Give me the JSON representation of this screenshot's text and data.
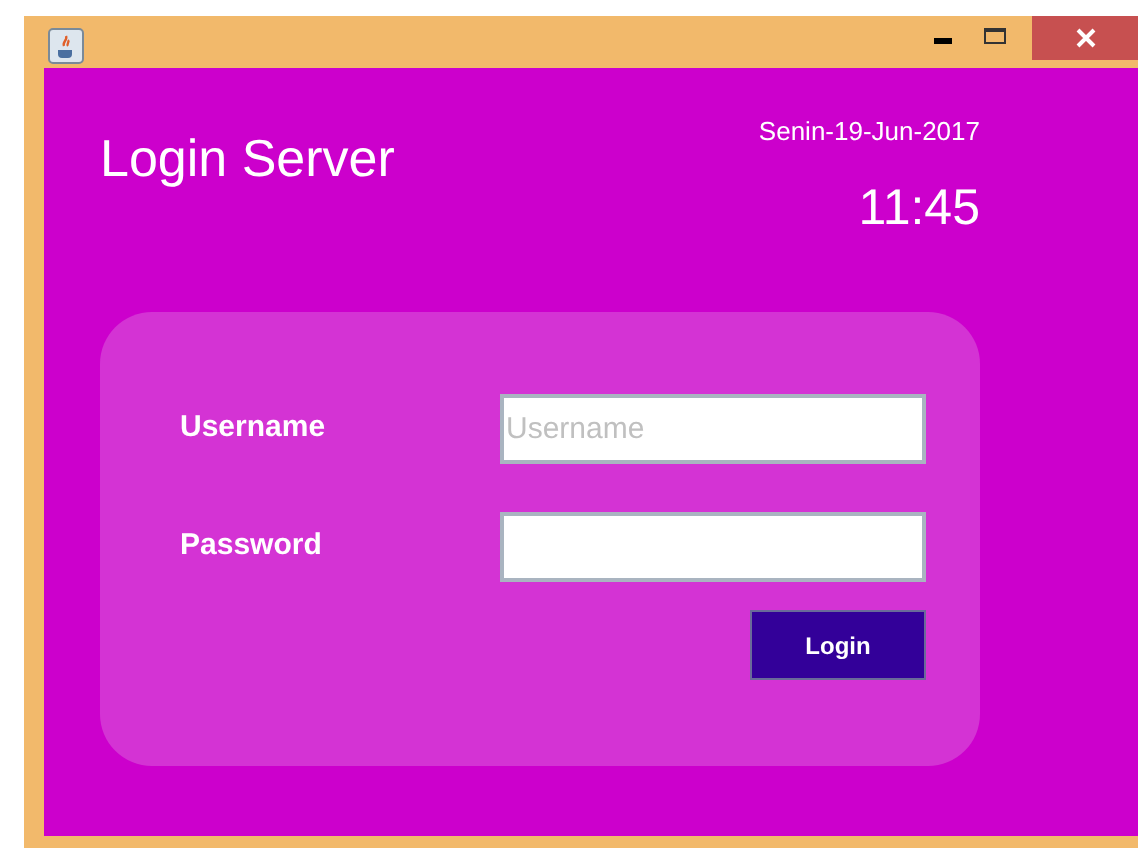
{
  "window": {
    "controls": [
      {
        "kind": "minimize"
      },
      {
        "kind": "maximize"
      },
      {
        "kind": "close"
      }
    ]
  },
  "header": {
    "title": "Login Server",
    "date": "Senin-19-Jun-2017",
    "time": "11:45"
  },
  "form": {
    "fields": [
      {
        "label": "Username",
        "placeholder": "Username"
      },
      {
        "label": "Password"
      }
    ],
    "button": "Login"
  }
}
